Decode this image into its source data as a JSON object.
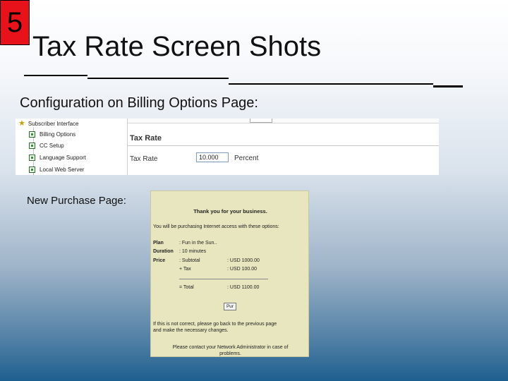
{
  "slide": {
    "number": "5",
    "title": "Tax Rate Screen Shots",
    "billing_label": "Configuration on Billing Options Page:",
    "purchase_label": "New Purchase Page:"
  },
  "billing_page": {
    "tree": [
      {
        "label": "Subscriber Interface",
        "icon": "star-icon"
      },
      {
        "label": "Billing Options",
        "icon": "page-icon"
      },
      {
        "label": "CC Setup",
        "icon": "page-icon"
      },
      {
        "label": "Language Support",
        "icon": "page-icon"
      },
      {
        "label": "Local Web Server",
        "icon": "page-icon"
      }
    ],
    "heading": "Tax Rate",
    "field_label": "Tax Rate",
    "field_value": "10.000",
    "field_unit": "Percent"
  },
  "purchase_page": {
    "thanks": "Thank you for your business.",
    "intro": "You will be purchasing Internet access with these options:",
    "plan_label": "Plan",
    "plan_value": ": Fun in the Sun..",
    "duration_label": "Duration",
    "duration_value": ": 10 minutes",
    "price_label": "Price",
    "subtotal_label": ": Subtotal",
    "subtotal_value": ": USD 1000.00",
    "tax_label": "+ Tax",
    "tax_value": ": USD 100.00",
    "total_label": "= Total",
    "total_value": ": USD 1100.00",
    "button_label": "Pur",
    "note_line1": "If this is not correct, please go back to the previous page",
    "note_line2": "and make the necessary changes.",
    "contact_line1": "Please contact your Network Administrator in case of",
    "contact_line2": "problems."
  }
}
